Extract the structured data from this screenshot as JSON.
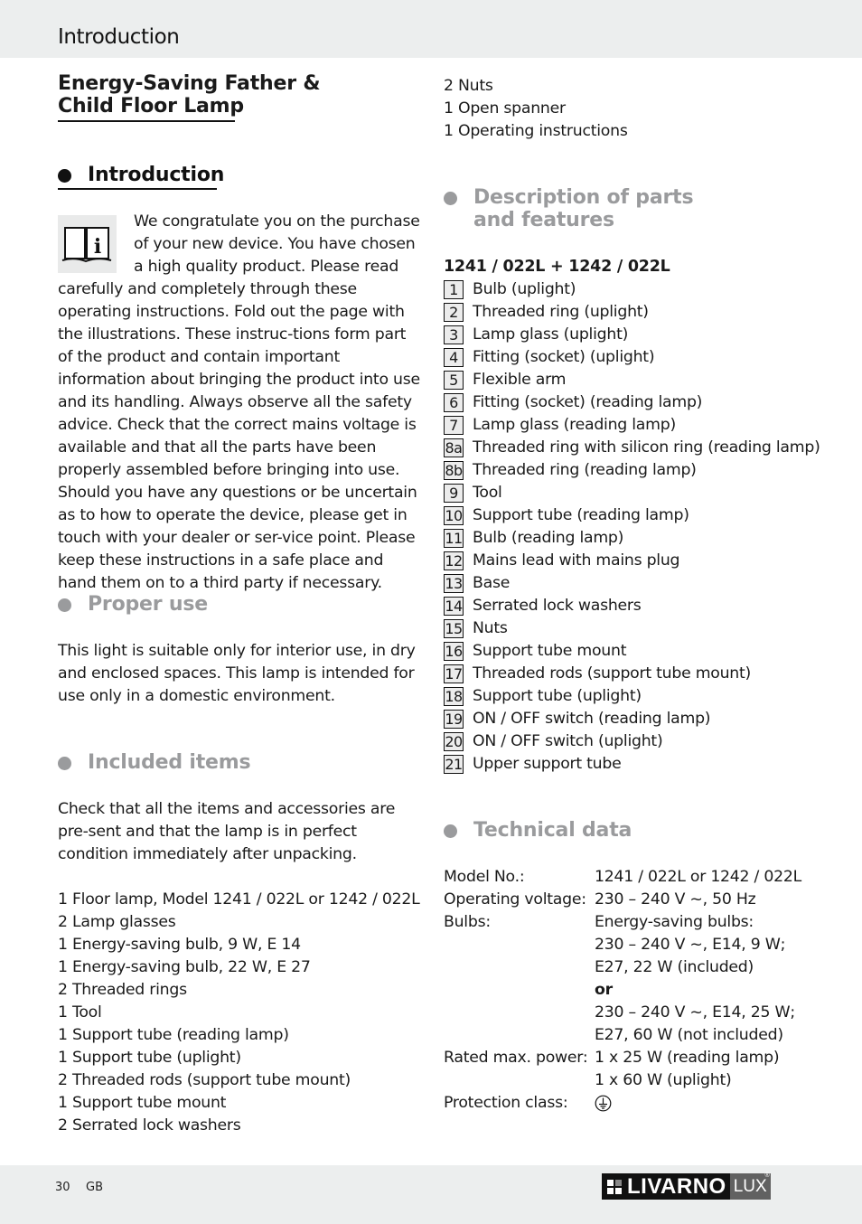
{
  "header": {
    "title": "Introduction"
  },
  "document": {
    "title_line1": "Energy-Saving Father &",
    "title_line2": "Child Floor Lamp"
  },
  "sections": {
    "introduction": {
      "heading": "Introduction",
      "icon": "book-info-icon",
      "paragraph": "We congratulate you on the purchase of your new device. You have chosen a high quality product. Please read carefully and completely through these operating instructions. Fold out the page with the illustrations. These instruc-tions form part of the product and contain important information about bringing the product into use and its handling. Always observe all the safety advice. Check that the correct mains voltage is available and that all the parts have been properly assembled before bringing into use. Should you have any questions or be uncertain as to how to operate the device, please get in touch with your dealer or ser-vice point. Please keep these instructions in a safe place and hand them on to a third party if necessary."
    },
    "proper_use": {
      "heading": "Proper use",
      "paragraph": "This light is suitable only for interior use, in dry and enclosed spaces. This lamp is intended for use only in a domestic environment."
    },
    "included_items": {
      "heading": "Included items",
      "paragraph": "Check that all the items and accessories are pre-sent and that the lamp is in perfect condition immediately after unpacking.",
      "items": [
        "1 Floor lamp, Model 1241 / 022L or 1242 / 022L",
        "2 Lamp glasses",
        "1 Energy-saving bulb, 9 W, E 14",
        "1 Energy-saving bulb, 22 W, E 27",
        "2 Threaded rings",
        "1 Tool",
        "1 Support tube (reading lamp)",
        "1 Support tube (uplight)",
        "2 Threaded rods (support tube mount)",
        "1 Support tube mount",
        "2 Serrated lock washers",
        "2 Nuts",
        "1 Open spanner",
        "1 Operating instructions"
      ]
    },
    "description": {
      "heading_line1": "Description of parts",
      "heading_line2": "and features",
      "model_heading": "1241 / 022L + 1242 / 022L",
      "parts": [
        {
          "num": "1",
          "label": "Bulb (uplight)"
        },
        {
          "num": "2",
          "label": "Threaded ring (uplight)"
        },
        {
          "num": "3",
          "label": "Lamp glass (uplight)"
        },
        {
          "num": "4",
          "label": "Fitting (socket) (uplight)"
        },
        {
          "num": "5",
          "label": "Flexible arm"
        },
        {
          "num": "6",
          "label": "Fitting (socket) (reading lamp)"
        },
        {
          "num": "7",
          "label": "Lamp glass (reading lamp)"
        },
        {
          "num": "8a",
          "label": "Threaded ring with silicon ring (reading lamp)"
        },
        {
          "num": "8b",
          "label": "Threaded ring (reading lamp)"
        },
        {
          "num": "9",
          "label": "Tool"
        },
        {
          "num": "10",
          "label": "Support tube (reading lamp)"
        },
        {
          "num": "11",
          "label": "Bulb (reading lamp)"
        },
        {
          "num": "12",
          "label": "Mains lead with mains plug"
        },
        {
          "num": "13",
          "label": "Base"
        },
        {
          "num": "14",
          "label": "Serrated lock washers"
        },
        {
          "num": "15",
          "label": "Nuts"
        },
        {
          "num": "16",
          "label": "Support tube mount"
        },
        {
          "num": "17",
          "label": "Threaded rods (support tube mount)"
        },
        {
          "num": "18",
          "label": "Support tube (uplight)"
        },
        {
          "num": "19",
          "label": "ON / OFF switch (reading lamp)"
        },
        {
          "num": "20",
          "label": "ON / OFF switch (uplight)"
        },
        {
          "num": "21",
          "label": "Upper support tube"
        }
      ]
    },
    "technical_data": {
      "heading": "Technical data",
      "rows": [
        {
          "label": "Model No.:",
          "values": [
            "1241 / 022L or 1242 / 022L"
          ]
        },
        {
          "label": "Operating voltage:",
          "values": [
            "230 – 240 V ~, 50 Hz"
          ]
        },
        {
          "label": "Bulbs:",
          "values": [
            "Energy-saving bulbs:",
            "230 – 240 V ~, E14, 9 W;",
            "E27, 22 W (included)",
            "or",
            "230 – 240 V ~, E14, 25 W;",
            "E27, 60 W (not included)"
          ]
        },
        {
          "label": "Rated max. power:",
          "values": [
            "1 x 25 W (reading lamp)",
            "1 x 60 W (uplight)"
          ]
        },
        {
          "label": "Protection class:",
          "values": [
            ""
          ],
          "icon": "protective-earth-icon"
        }
      ]
    }
  },
  "footer": {
    "page_number": "30",
    "language": "GB",
    "logo_main": "LIVARNO",
    "logo_sub": "LUX",
    "logo_reg": "®"
  },
  "colors": {
    "band_gray": "#eceeee",
    "heading_gray": "#9a9b9d",
    "text_black": "#1a1a1a"
  }
}
